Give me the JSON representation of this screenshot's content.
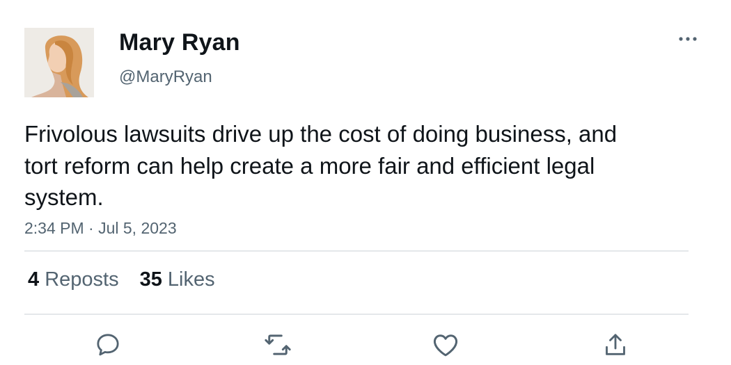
{
  "tweet": {
    "author": {
      "display_name": "Mary Ryan",
      "handle": "@MaryRyan",
      "avatar_icon": "woman-profile-photo"
    },
    "text": "Frivolous lawsuits drive up the cost of doing business, and tort reform can help create a more fair and efficient legal system.",
    "timestamp": "2:34 PM · Jul 5, 2023",
    "stats": {
      "reposts_count": "4",
      "reposts_label": "Reposts",
      "likes_count": "35",
      "likes_label": "Likes"
    },
    "actions": [
      "reply-icon",
      "repost-icon",
      "like-icon",
      "share-icon"
    ],
    "more_icon": "more-horizontal-icon"
  },
  "colors": {
    "text_primary": "#0f1419",
    "text_secondary": "#536471",
    "divider": "#e4e7ea",
    "icon": "#536471"
  }
}
